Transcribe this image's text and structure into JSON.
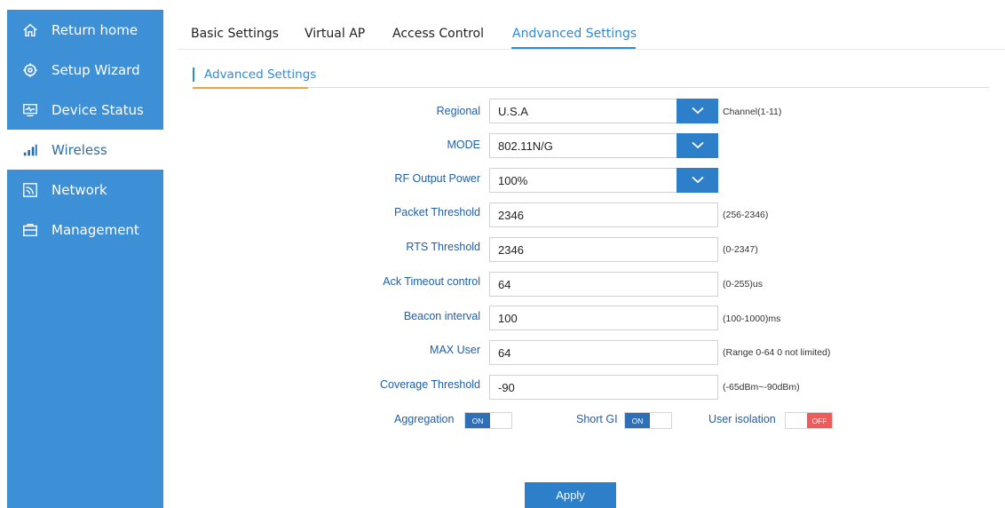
{
  "sidebar": {
    "items": [
      {
        "label": "Return home",
        "icon": "home-icon"
      },
      {
        "label": "Setup Wizard",
        "icon": "gear-icon"
      },
      {
        "label": "Device Status",
        "icon": "monitor-icon"
      },
      {
        "label": "Wireless",
        "icon": "signal-bars-icon",
        "active": true
      },
      {
        "label": "Network",
        "icon": "network-icon"
      },
      {
        "label": "Management",
        "icon": "briefcase-icon"
      }
    ]
  },
  "tabs": [
    {
      "label": "Basic Settings"
    },
    {
      "label": "Virtual AP"
    },
    {
      "label": "Access Control"
    },
    {
      "label": "Andvanced Settings",
      "active": true
    }
  ],
  "section": {
    "title": "Advanced Settings"
  },
  "form": {
    "regional": {
      "label": "Regional",
      "value": "U.S.A",
      "hint": "Channel(1-11)"
    },
    "mode": {
      "label": "MODE",
      "value": "802.11N/G"
    },
    "rf_power": {
      "label": "RF Output Power",
      "value": "100%"
    },
    "packet_threshold": {
      "label": "Packet Threshold",
      "value": "2346",
      "hint": "(256-2346)"
    },
    "rts_threshold": {
      "label": "RTS Threshold",
      "value": "2346",
      "hint": "(0-2347)"
    },
    "ack_timeout": {
      "label": "Ack Timeout control",
      "value": "64",
      "hint": "(0-255)us"
    },
    "beacon_interval": {
      "label": "Beacon interval",
      "value": "100",
      "hint": "(100-1000)ms"
    },
    "max_user": {
      "label": "MAX User",
      "value": "64",
      "hint": "(Range 0-64 0 not limited)"
    },
    "coverage_threshold": {
      "label": "Coverage Threshold",
      "value": "-90",
      "hint": "(-65dBm~-90dBm)"
    }
  },
  "toggles": {
    "aggregation": {
      "label": "Aggregation",
      "state": "ON"
    },
    "short_gi": {
      "label": "Short GI",
      "state": "ON"
    },
    "user_isolation": {
      "label": "User isolation",
      "state": "OFF"
    }
  },
  "apply_label": "Apply",
  "colors": {
    "primary": "#3d8fd6",
    "accent": "#2e8ad8",
    "off": "#ef5a5a",
    "section_accent": "#f2a23a"
  }
}
